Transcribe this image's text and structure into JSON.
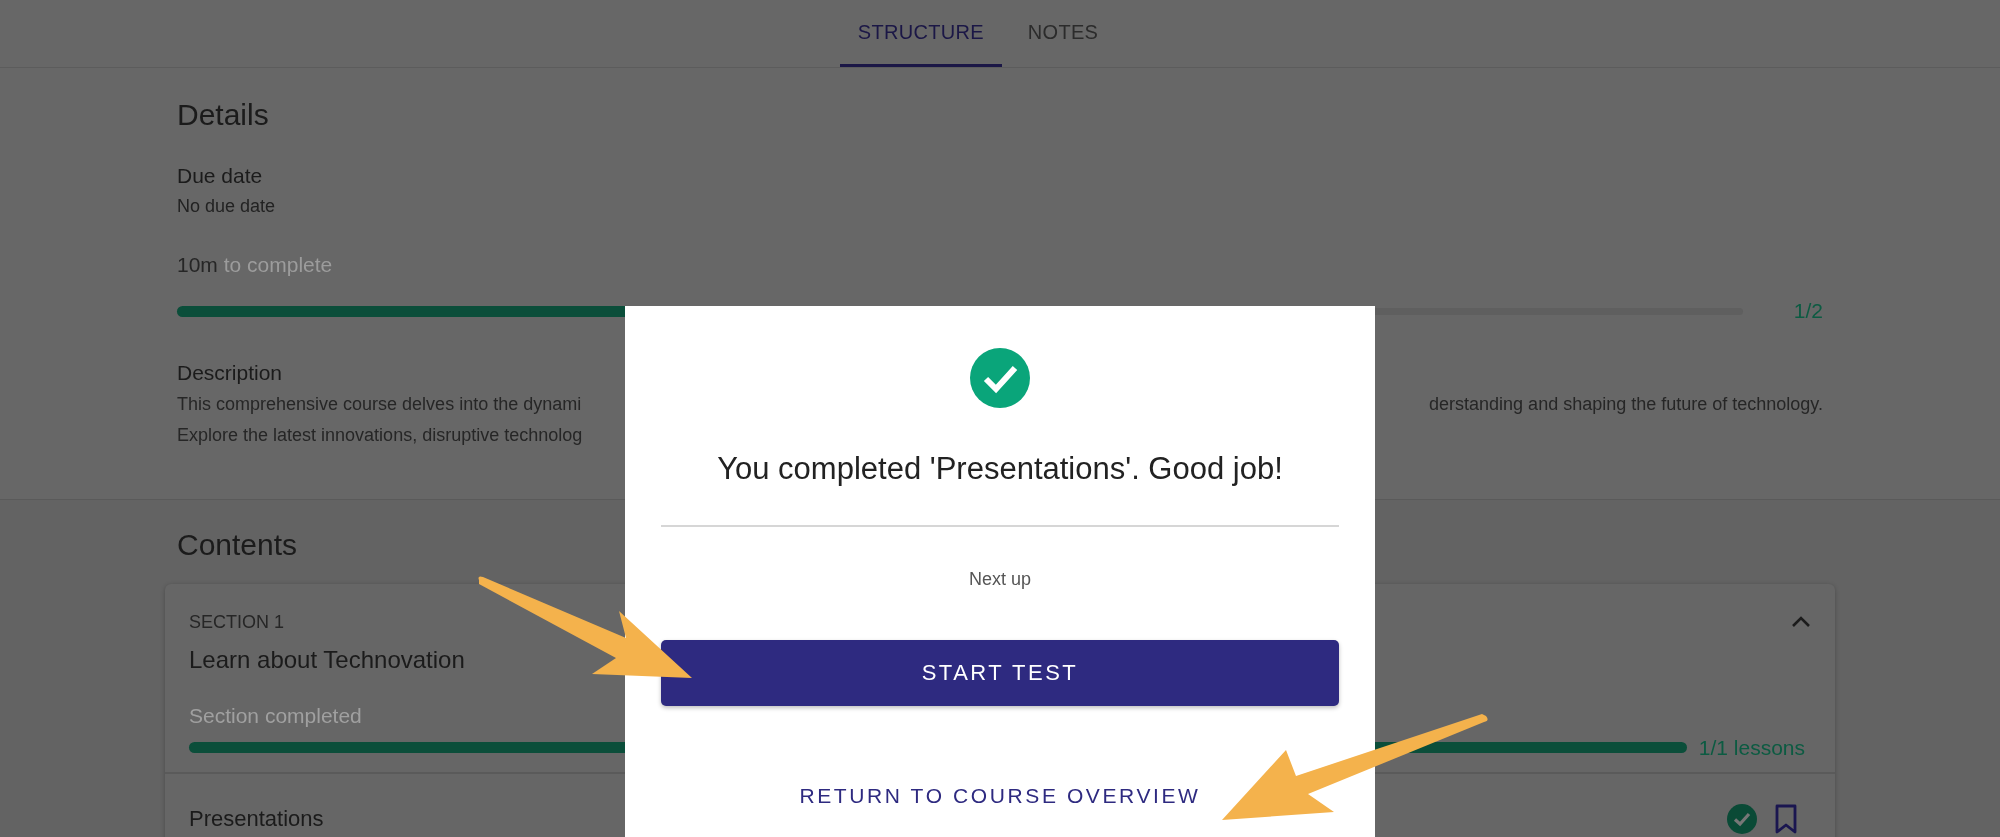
{
  "tabs": [
    {
      "label": "STRUCTURE",
      "selected": true
    },
    {
      "label": "NOTES",
      "selected": false
    }
  ],
  "details": {
    "heading": "Details",
    "due_label": "Due date",
    "due_value": "No due date",
    "duration": "10m",
    "duration_suffix": "to complete",
    "progress": {
      "level": 0.6,
      "reading": "1/2"
    },
    "description": {
      "label": "Description",
      "lines": [
        {
          "left": "This comprehensive course delves into the dynami",
          "right": "derstanding and shaping the future of technology."
        },
        {
          "left": "Explore the latest innovations, disruptive technolog"
        }
      ]
    }
  },
  "contents": {
    "heading": "Contents",
    "sections": [
      {
        "eyebrow": "SECTION 1",
        "title": "Learn about Technovation",
        "expanded": true,
        "status": "Section completed",
        "progress": {
          "level": 1,
          "reading": "1/1 lessons"
        },
        "lessons": [
          {
            "title": "Presentations",
            "completed": true,
            "bookmarked": false
          }
        ]
      }
    ]
  },
  "dialog": {
    "title": "You completed 'Presentations'. Good job!",
    "next_label": "Next up",
    "primary_button": "START TEST",
    "secondary_button": "RETURN TO COURSE OVERVIEW"
  }
}
